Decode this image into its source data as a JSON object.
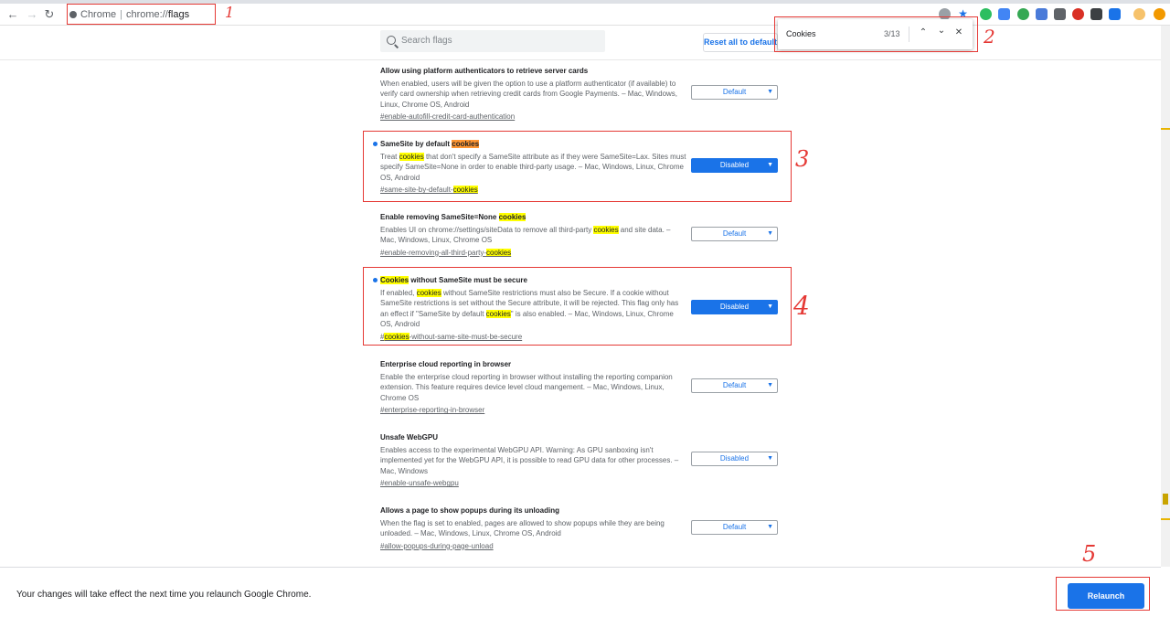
{
  "browser": {
    "omnibox_site": "Chrome",
    "omnibox_sep": "|",
    "omnibox_scheme": "chrome://",
    "omnibox_path": "flags",
    "colors": {
      "accent": "#1a73e8",
      "highlight": "#ffff00",
      "current_match": "#ff9632",
      "annotation": "#e53935"
    }
  },
  "header": {
    "search_placeholder": "Search flags",
    "reset_label": "Reset all to default"
  },
  "findbar": {
    "query": "Cookies",
    "count": "3/13",
    "prev_icon": "chevron-up-icon",
    "next_icon": "chevron-down-icon",
    "close_icon": "close-icon"
  },
  "annotations": [
    "1",
    "2",
    "3",
    "4",
    "5"
  ],
  "flags": [
    {
      "title": "Allow using platform authenticators to retrieve server cards",
      "desc": "When enabled, users will be given the option to use a platform authenticator (if available) to verify card ownership when retrieving credit cards from Google Payments. – Mac, Windows, Linux, Chrome OS, Android",
      "anchor": "#enable-autofill-credit-card-authentication",
      "value": "Default"
    },
    {
      "title_pre": "SameSite by default ",
      "title_hl": "cookies",
      "desc_a": "Treat ",
      "desc_hl": "cookies",
      "desc_b": " that don't specify a SameSite attribute as if they were SameSite=Lax. Sites must specify SameSite=None in order to enable third-party usage. – Mac, Windows, Linux, Chrome OS, Android",
      "anchor_pre": "#same-site-by-default-",
      "anchor_hl": "cookies",
      "value": "Disabled"
    },
    {
      "title_pre": "Enable removing SameSite=None ",
      "title_hl": "cookies",
      "desc_a": "Enables UI on chrome://settings/siteData to remove all third-party ",
      "desc_hl": "cookies",
      "desc_b": " and site data. – Mac, Windows, Linux, Chrome OS",
      "anchor_pre": "#enable-removing-all-third-party-",
      "anchor_hl": "cookies",
      "value": "Default"
    },
    {
      "title_hl": "Cookies",
      "title_post": " without SameSite must be secure",
      "desc_a": "If enabled, ",
      "desc_hl": "cookies",
      "desc_b": " without SameSite restrictions must also be Secure. If a cookie without SameSite restrictions is set without the Secure attribute, it will be rejected. This flag only has an effect if \"SameSite by default ",
      "desc_hl2": "cookies",
      "desc_c": "\" is also enabled. – Mac, Windows, Linux, Chrome OS, Android",
      "anchor_pre": "#",
      "anchor_hl": "cookies",
      "anchor_post": "-without-same-site-must-be-secure",
      "value": "Disabled"
    },
    {
      "title": "Enterprise cloud reporting in browser",
      "desc": "Enable the enterprise cloud reporting in browser without installing the reporting companion extension. This feature requires device level cloud mangement. – Mac, Windows, Linux, Chrome OS",
      "anchor": "#enterprise-reporting-in-browser",
      "value": "Default"
    },
    {
      "title": "Unsafe WebGPU",
      "desc": "Enables access to the experimental WebGPU API. Warning: As GPU sanboxing isn't implemented yet for the WebGPU API, it is possible to read GPU data for other processes. – Mac, Windows",
      "anchor": "#enable-unsafe-webgpu",
      "value": "Disabled"
    },
    {
      "title": "Allows a page to show popups during its unloading",
      "desc": "When the flag is set to enabled, pages are allowed to show popups while they are being unloaded. – Mac, Windows, Linux, Chrome OS, Android",
      "anchor": "#allow-popups-during-page-unload",
      "value": "Default"
    }
  ],
  "footer": {
    "message": "Your changes will take effect the next time you relaunch Google Chrome.",
    "relaunch_label": "Relaunch"
  }
}
